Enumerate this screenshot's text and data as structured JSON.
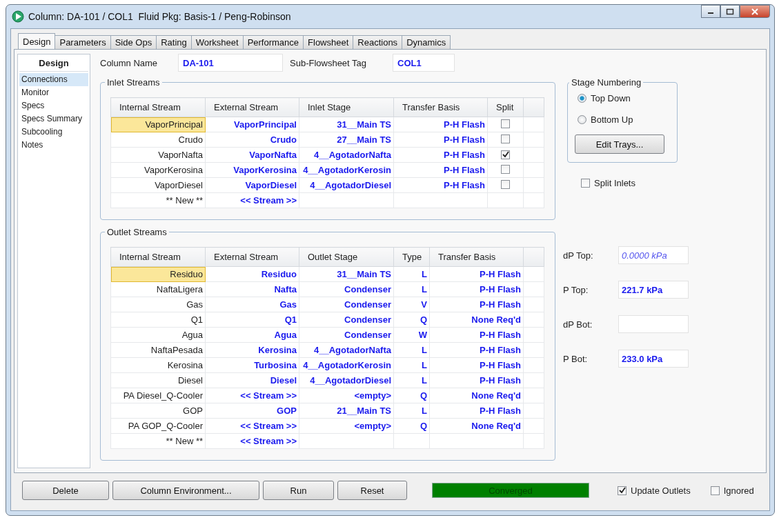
{
  "window": {
    "title": "Column: DA-101 / COL1  Fluid Pkg: Basis-1 / Peng-Robinson"
  },
  "tabs": [
    {
      "label": "Design",
      "selected": true
    },
    {
      "label": "Parameters",
      "selected": false
    },
    {
      "label": "Side Ops",
      "selected": false
    },
    {
      "label": "Rating",
      "selected": false
    },
    {
      "label": "Worksheet",
      "selected": false
    },
    {
      "label": "Performance",
      "selected": false
    },
    {
      "label": "Flowsheet",
      "selected": false
    },
    {
      "label": "Reactions",
      "selected": false
    },
    {
      "label": "Dynamics",
      "selected": false
    }
  ],
  "sidebar": {
    "title": "Design",
    "items": [
      {
        "label": "Connections",
        "selected": true
      },
      {
        "label": "Monitor",
        "selected": false
      },
      {
        "label": "Specs",
        "selected": false
      },
      {
        "label": "Specs Summary",
        "selected": false
      },
      {
        "label": "Subcooling",
        "selected": false
      },
      {
        "label": "Notes",
        "selected": false
      }
    ]
  },
  "column_name": {
    "label": "Column Name",
    "value": "DA-101"
  },
  "sub_flowsheet_tag": {
    "label": "Sub-Flowsheet Tag",
    "value": "COL1"
  },
  "inlet_streams": {
    "title": "Inlet Streams",
    "columns": [
      "Internal Stream",
      "External Stream",
      "Inlet Stage",
      "Transfer Basis",
      "Split"
    ],
    "rows": [
      {
        "cells": [
          "VaporPrincipal",
          "VaporPrincipal",
          "31__Main TS",
          "P-H Flash"
        ],
        "split": false,
        "selected": true
      },
      {
        "cells": [
          "Crudo",
          "Crudo",
          "27__Main TS",
          "P-H Flash"
        ],
        "split": false,
        "selected": false
      },
      {
        "cells": [
          "VaporNafta",
          "VaporNafta",
          "4__AgotadorNafta",
          "P-H Flash"
        ],
        "split": true,
        "selected": false
      },
      {
        "cells": [
          "VaporKerosina",
          "VaporKerosina",
          "4__AgotadorKerosin",
          "P-H Flash"
        ],
        "split": false,
        "selected": false
      },
      {
        "cells": [
          "VaporDiesel",
          "VaporDiesel",
          "4__AgotadorDiesel",
          "P-H Flash"
        ],
        "split": false,
        "selected": false
      },
      {
        "cells": [
          "** New **",
          "<< Stream >>"
        ],
        "selected": false
      }
    ]
  },
  "outlet_streams": {
    "title": "Outlet Streams",
    "columns": [
      "Internal Stream",
      "External Stream",
      "Outlet Stage",
      "Type",
      "Transfer Basis"
    ],
    "rows": [
      {
        "cells": [
          "Residuo",
          "Residuo",
          "31__Main TS",
          "L",
          "P-H Flash"
        ],
        "selected": true
      },
      {
        "cells": [
          "NaftaLigera",
          "Nafta",
          "Condenser",
          "L",
          "P-H Flash"
        ],
        "selected": false
      },
      {
        "cells": [
          "Gas",
          "Gas",
          "Condenser",
          "V",
          "P-H Flash"
        ],
        "selected": false
      },
      {
        "cells": [
          "Q1",
          "Q1",
          "Condenser",
          "Q",
          "None Req'd"
        ],
        "selected": false
      },
      {
        "cells": [
          "Agua",
          "Agua",
          "Condenser",
          "W",
          "P-H Flash"
        ],
        "selected": false
      },
      {
        "cells": [
          "NaftaPesada",
          "Kerosina",
          "4__AgotadorNafta",
          "L",
          "P-H Flash"
        ],
        "selected": false
      },
      {
        "cells": [
          "Kerosina",
          "Turbosina",
          "4__AgotadorKerosin",
          "L",
          "P-H Flash"
        ],
        "selected": false
      },
      {
        "cells": [
          "Diesel",
          "Diesel",
          "4__AgotadorDiesel",
          "L",
          "P-H Flash"
        ],
        "selected": false
      },
      {
        "cells": [
          "PA Diesel_Q-Cooler",
          "<< Stream >>",
          "<empty>",
          "Q",
          "None Req'd"
        ],
        "selected": false
      },
      {
        "cells": [
          "GOP",
          "GOP",
          "21__Main TS",
          "L",
          "P-H Flash"
        ],
        "selected": false
      },
      {
        "cells": [
          "PA GOP_Q-Cooler",
          "<< Stream >>",
          "<empty>",
          "Q",
          "None Req'd"
        ],
        "selected": false
      },
      {
        "cells": [
          "** New **",
          "<< Stream >>"
        ],
        "selected": false
      }
    ]
  },
  "stage_numbering": {
    "title": "Stage Numbering",
    "options": [
      {
        "label": "Top Down",
        "selected": true
      },
      {
        "label": "Bottom Up",
        "selected": false
      }
    ],
    "button": "Edit Trays..."
  },
  "split_inlets": {
    "label": "Split Inlets",
    "checked": false
  },
  "pressures": [
    {
      "label": "dP Top:",
      "value": "0.0000 kPa",
      "kind": "default"
    },
    {
      "label": "P Top:",
      "value": "221.7 kPa",
      "kind": "input"
    },
    {
      "label": "dP Bot:",
      "kind": "input"
    },
    {
      "label": "P Bot:",
      "value": "233.0 kPa",
      "kind": "input"
    }
  ],
  "buttons": [
    "Delete",
    "Column Environment...",
    "Run",
    "Reset"
  ],
  "status": {
    "text": "Converged"
  },
  "options": [
    {
      "label": "Update Outlets",
      "checked": true
    },
    {
      "label": "Ignored",
      "checked": false
    }
  ]
}
